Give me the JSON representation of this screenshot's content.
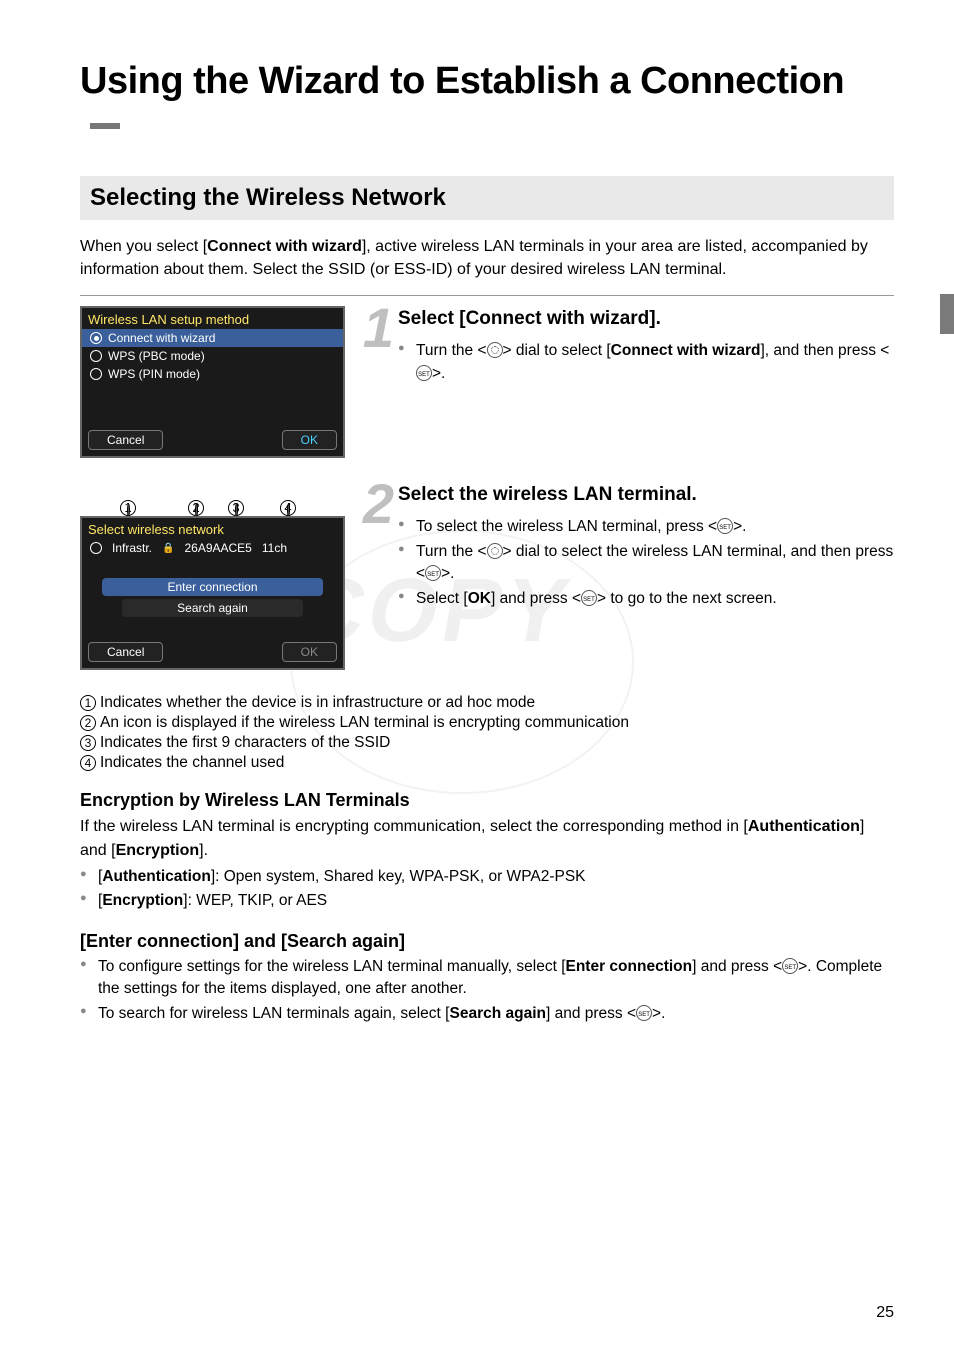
{
  "page_title": "Using the Wizard to Establish a Connection",
  "section_heading": "Selecting the Wireless Network",
  "intro_prefix": "When you select [",
  "intro_bold": "Connect with wizard",
  "intro_suffix": "], active wireless LAN terminals in your area are listed, accompanied by information about them. Select the SSID (or ESS-ID) of your desired wireless LAN terminal.",
  "step1": {
    "num": "1",
    "heading": "Select [Connect with wizard].",
    "b1_a": "Turn the <",
    "b1_b": "> dial to select [",
    "b1_bold": "Connect with wizard",
    "b1_c": "], and then press <",
    "b1_d": ">."
  },
  "cam1": {
    "title": "Wireless LAN setup method",
    "opt1": "Connect with wizard",
    "opt2": "WPS (PBC mode)",
    "opt3": "WPS (PIN mode)",
    "cancel": "Cancel",
    "ok": "OK"
  },
  "step2": {
    "num": "2",
    "heading": "Select the wireless LAN terminal.",
    "b1_a": "To select the wireless LAN terminal, press <",
    "b1_b": ">.",
    "b2_a": "Turn the <",
    "b2_b": "> dial to select the wireless LAN terminal, and then press <",
    "b2_c": ">.",
    "b3_a": "Select [",
    "b3_bold": "OK",
    "b3_b": "] and press <",
    "b3_c": "> to go to the next screen."
  },
  "cam2": {
    "title": "Select wireless network",
    "mode": "Infrastr.",
    "ssid": "26A9AACE5",
    "chan": "11ch",
    "enter": "Enter connection",
    "search": "Search again",
    "cancel": "Cancel",
    "ok": "OK"
  },
  "legend": {
    "l1": "Indicates whether the device is in infrastructure or ad hoc mode",
    "l2": "An icon is displayed if the wireless LAN terminal is encrypting communication",
    "l3": "Indicates the first 9 characters of the SSID",
    "l4": "Indicates the channel used"
  },
  "enc": {
    "heading": "Encryption by Wireless LAN Terminals",
    "p_a": "If the wireless LAN terminal is encrypting communication, select the corresponding method in [",
    "p_b1": "Authentication",
    "p_c": "] and [",
    "p_b2": "Encryption",
    "p_d": "].",
    "li1_a": "[",
    "li1_b": "Authentication",
    "li1_c": "]: Open system, Shared key, WPA-PSK, or WPA2-PSK",
    "li2_a": "[",
    "li2_b": "Encryption",
    "li2_c": "]: WEP, TKIP, or AES"
  },
  "es": {
    "heading": "[Enter connection] and [Search again]",
    "li1_a": "To configure settings for the wireless LAN terminal manually, select [",
    "li1_bold": "Enter connection",
    "li1_b": "] and press <",
    "li1_c": ">. Complete the settings for the items displayed, one after another.",
    "li2_a": "To search for wireless LAN terminals again, select [",
    "li2_bold": "Search again",
    "li2_b": "] and press <",
    "li2_c": ">."
  },
  "page_number": "25",
  "watermark": "COPY"
}
